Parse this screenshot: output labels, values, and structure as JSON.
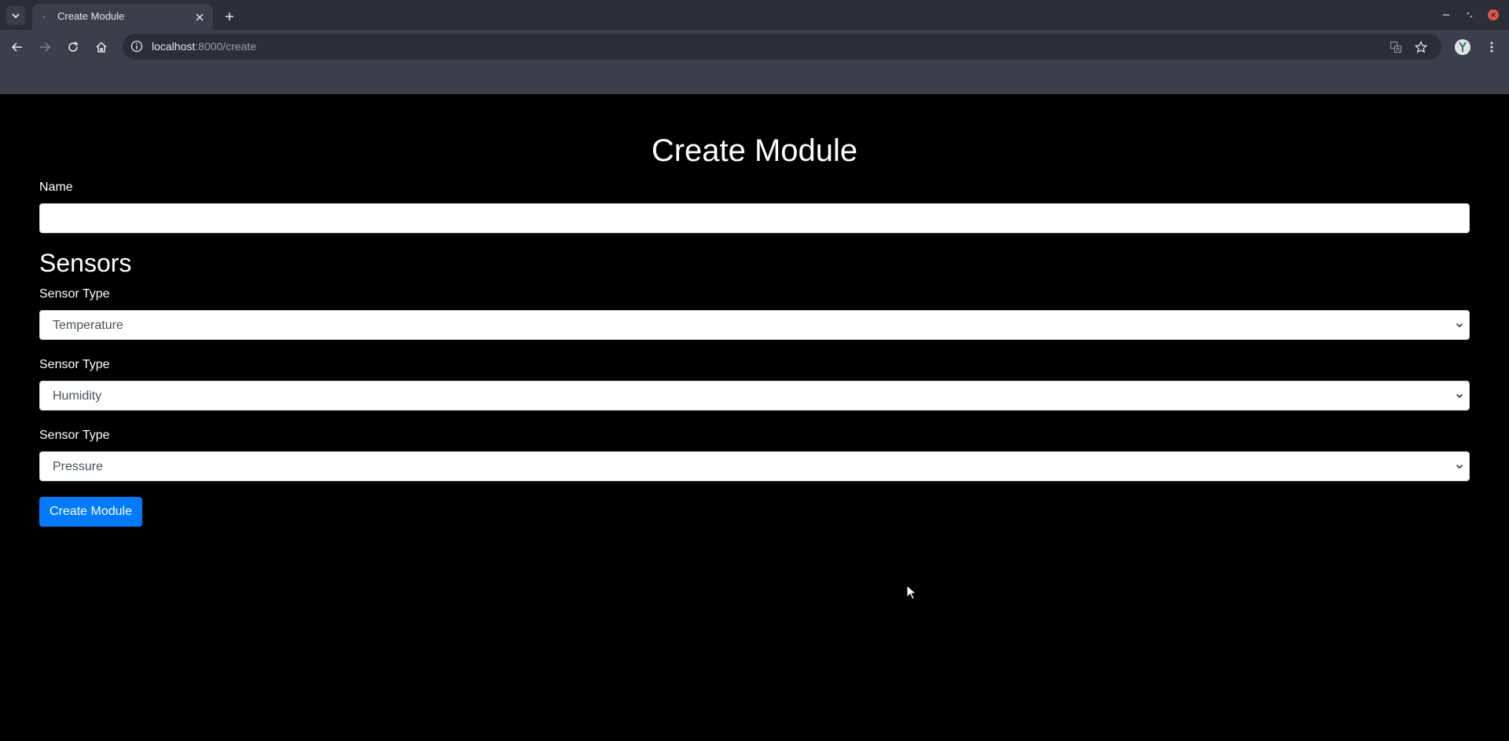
{
  "browser": {
    "tab": {
      "title": "Create Module"
    },
    "address": {
      "host": "localhost",
      "path": ":8000/create"
    }
  },
  "page": {
    "title": "Create Module",
    "name_label": "Name",
    "name_value": "",
    "sensors_heading": "Sensors",
    "sensors": [
      {
        "label": "Sensor Type",
        "selected": "Temperature"
      },
      {
        "label": "Sensor Type",
        "selected": "Humidity"
      },
      {
        "label": "Sensor Type",
        "selected": "Pressure"
      }
    ],
    "submit_label": "Create Module"
  },
  "colors": {
    "page_bg": "#000000",
    "primary": "#007bff",
    "chrome_dark": "#2b2e36",
    "chrome_light": "#3b3f4a"
  }
}
